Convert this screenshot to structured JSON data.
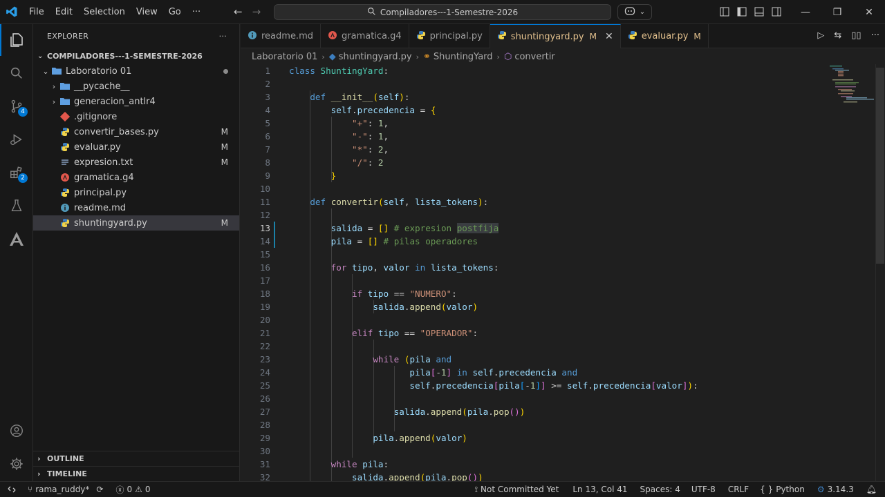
{
  "menu": [
    "File",
    "Edit",
    "Selection",
    "View",
    "Go",
    "···"
  ],
  "command_center": "Compiladores---1-Semestre-2026",
  "sidebar": {
    "title": "EXPLORER",
    "more": "···",
    "root": "COMPILADORES---1-SEMESTRE-2026",
    "folder": "Laboratorio 01",
    "items": [
      {
        "label": "__pycache__",
        "type": "folder",
        "mod": ""
      },
      {
        "label": "generacion_antlr4",
        "type": "folder",
        "mod": ""
      },
      {
        "label": ".gitignore",
        "type": "git",
        "mod": ""
      },
      {
        "label": "convertir_bases.py",
        "type": "py",
        "mod": "M"
      },
      {
        "label": "evaluar.py",
        "type": "py",
        "mod": "M"
      },
      {
        "label": "expresion.txt",
        "type": "txt",
        "mod": "M"
      },
      {
        "label": "gramatica.g4",
        "type": "antlr",
        "mod": ""
      },
      {
        "label": "principal.py",
        "type": "py",
        "mod": ""
      },
      {
        "label": "readme.md",
        "type": "info",
        "mod": ""
      },
      {
        "label": "shuntingyard.py",
        "type": "py",
        "mod": "M"
      }
    ],
    "outline": "OUTLINE",
    "timeline": "TIMELINE"
  },
  "activity_badges": {
    "scm": "4",
    "extensions": "2"
  },
  "tabs": [
    {
      "label": "readme.md",
      "icon": "info",
      "mod": ""
    },
    {
      "label": "gramatica.g4",
      "icon": "antlr",
      "mod": ""
    },
    {
      "label": "principal.py",
      "icon": "py",
      "mod": ""
    },
    {
      "label": "shuntingyard.py",
      "icon": "py",
      "mod": "M",
      "active": true
    },
    {
      "label": "evaluar.py",
      "icon": "py",
      "mod": "M"
    }
  ],
  "breadcrumb": [
    "Laboratorio 01",
    "shuntingyard.py",
    "ShuntingYard",
    "convertir"
  ],
  "code_lines": [
    "class ShuntingYard:",
    "",
    "    def __init__(self):",
    "        self.precedencia = {",
    "            \"+\": 1,",
    "            \"-\": 1,",
    "            \"*\": 2,",
    "            \"/\": 2",
    "        }",
    "",
    "    def convertir(self, lista_tokens):",
    "",
    "        salida = [] # expresion postfija",
    "        pila = [] # pilas operadores",
    "",
    "        for tipo, valor in lista_tokens:",
    "",
    "            if tipo == \"NUMERO\":",
    "                salida.append(valor)",
    "",
    "            elif tipo == \"OPERADOR\":",
    "",
    "                while (pila and",
    "                       pila[-1] in self.precedencia and",
    "                       self.precedencia[pila[-1]] >= self.precedencia[valor]):",
    "",
    "                    salida.append(pila.pop())",
    "",
    "                pila.append(valor)",
    "",
    "        while pila:",
    "            salida.append(pila.pop())"
  ],
  "status": {
    "branch": "rama_ruddy*",
    "errors": "0",
    "warnings": "0",
    "commit": "Not Committed Yet",
    "position": "Ln 13, Col 41",
    "spaces": "Spaces: 4",
    "encoding": "UTF-8",
    "eol": "CRLF",
    "language": "Python",
    "version": "3.14.3"
  },
  "colors": {
    "accent": "#0078d4",
    "modified": "#e2c08d",
    "python": "#3c7ebf"
  }
}
